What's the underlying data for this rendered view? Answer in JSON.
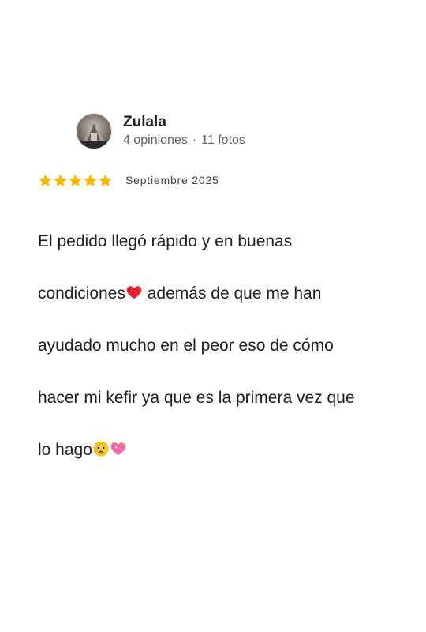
{
  "review": {
    "author": {
      "name": "Zulala",
      "reviews_count": "4 opiniones",
      "photos_count": "11 fotos",
      "separator": "·",
      "avatar_icon": "avatar-photo"
    },
    "rating": {
      "stars": 5,
      "max": 5,
      "color": "#f6b800"
    },
    "date": "Septiembre 2025",
    "text": {
      "line1": "El pedido llegó rápido y en buenas",
      "line2_a": "condiciones",
      "line2_b": " además de que me han",
      "line3": "ayudado mucho en el peor eso de cómo",
      "line4": "hacer mi kefir ya que es la primera vez que",
      "line5": "lo hago",
      "emojis": [
        "red-heart-emoji",
        "holding-back-tears-emoji",
        "sparkling-heart-emoji"
      ]
    }
  }
}
